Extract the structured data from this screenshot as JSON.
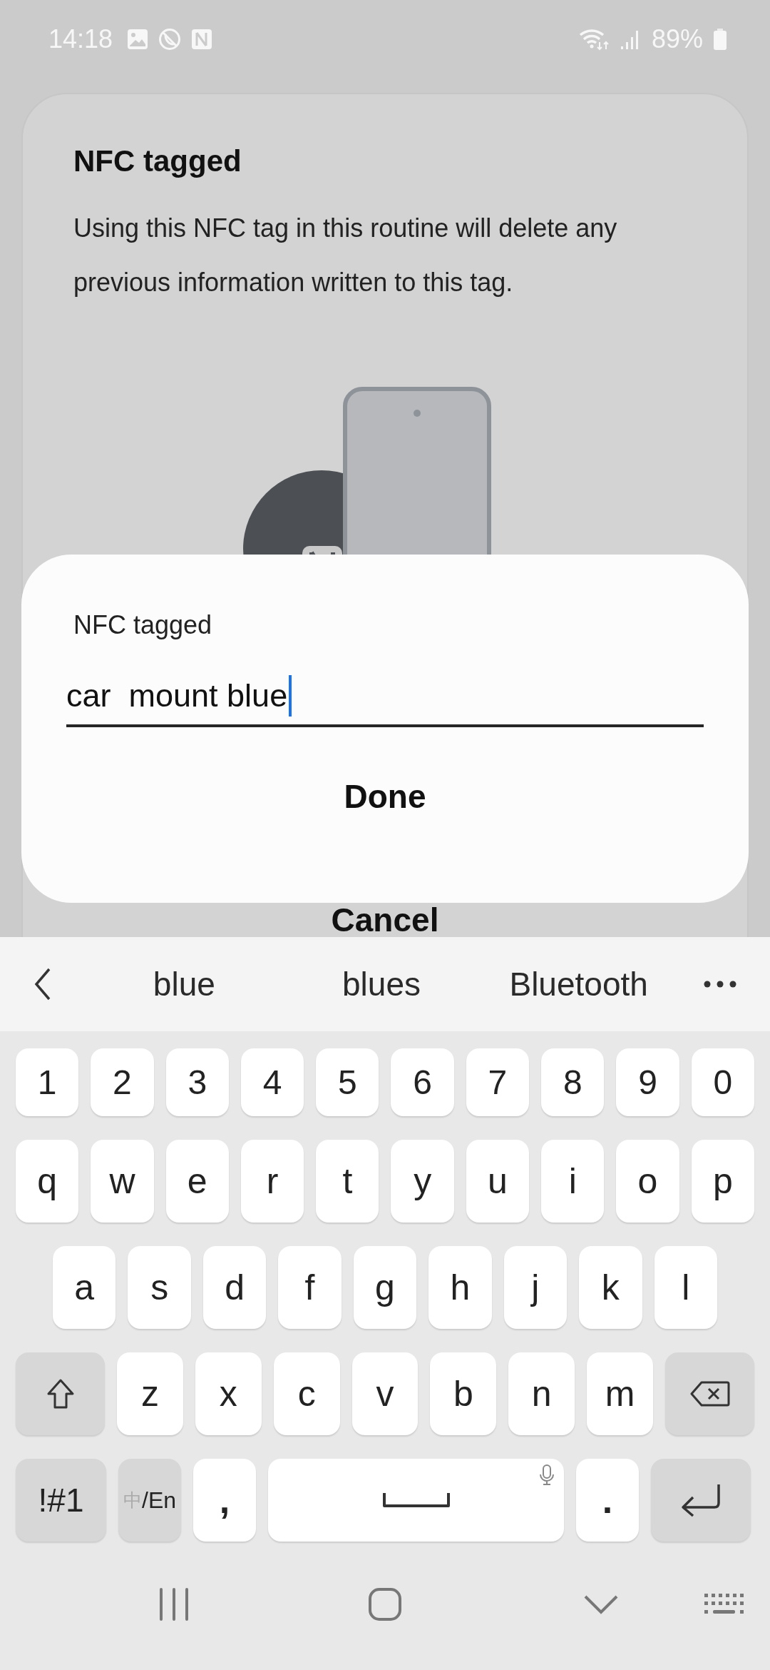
{
  "status_bar": {
    "time": "14:18",
    "battery": "89%"
  },
  "card": {
    "title": "NFC tagged",
    "body": "Using this NFC tag in this routine will delete any previous information written to this tag.",
    "button": "Cancel"
  },
  "dialog": {
    "label": "NFC tagged",
    "field": {
      "value": "car  mount blue",
      "focused": true
    },
    "button": "Done"
  },
  "keyboard": {
    "suggestions": [
      "blue",
      "blues",
      "Bluetooth"
    ],
    "rows": [
      [
        {
          "kind": "char",
          "label": "1"
        },
        {
          "kind": "char",
          "label": "2"
        },
        {
          "kind": "char",
          "label": "3"
        },
        {
          "kind": "char",
          "label": "4"
        },
        {
          "kind": "char",
          "label": "5"
        },
        {
          "kind": "char",
          "label": "6"
        },
        {
          "kind": "char",
          "label": "7"
        },
        {
          "kind": "char",
          "label": "8"
        },
        {
          "kind": "char",
          "label": "9"
        },
        {
          "kind": "char",
          "label": "0"
        }
      ],
      [
        {
          "kind": "char",
          "label": "q"
        },
        {
          "kind": "char",
          "label": "w"
        },
        {
          "kind": "char",
          "label": "e"
        },
        {
          "kind": "char",
          "label": "r"
        },
        {
          "kind": "char",
          "label": "t"
        },
        {
          "kind": "char",
          "label": "y"
        },
        {
          "kind": "char",
          "label": "u"
        },
        {
          "kind": "char",
          "label": "i"
        },
        {
          "kind": "char",
          "label": "o"
        },
        {
          "kind": "char",
          "label": "p"
        }
      ],
      [
        {
          "kind": "char",
          "label": "a"
        },
        {
          "kind": "char",
          "label": "s"
        },
        {
          "kind": "char",
          "label": "d"
        },
        {
          "kind": "char",
          "label": "f"
        },
        {
          "kind": "char",
          "label": "g"
        },
        {
          "kind": "char",
          "label": "h"
        },
        {
          "kind": "char",
          "label": "j"
        },
        {
          "kind": "char",
          "label": "k"
        },
        {
          "kind": "char",
          "label": "l"
        }
      ],
      [
        {
          "kind": "shift"
        },
        {
          "kind": "char",
          "label": "z"
        },
        {
          "kind": "char",
          "label": "x"
        },
        {
          "kind": "char",
          "label": "c"
        },
        {
          "kind": "char",
          "label": "v"
        },
        {
          "kind": "char",
          "label": "b"
        },
        {
          "kind": "char",
          "label": "n"
        },
        {
          "kind": "char",
          "label": "m"
        },
        {
          "kind": "backspace"
        }
      ],
      [
        {
          "kind": "symbols",
          "label": "!#1"
        },
        {
          "kind": "lang",
          "dim": "中",
          "label": "/En"
        },
        {
          "kind": "punct",
          "label": ","
        },
        {
          "kind": "space"
        },
        {
          "kind": "punct",
          "label": "."
        },
        {
          "kind": "enter"
        }
      ]
    ]
  }
}
